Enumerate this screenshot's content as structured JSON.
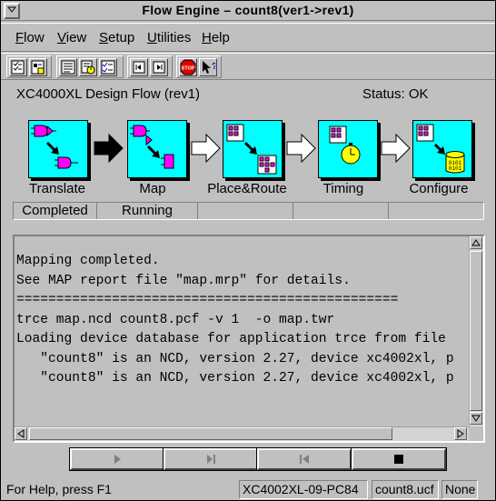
{
  "window": {
    "title": "Flow Engine – count8(ver1->rev1)"
  },
  "menubar": [
    {
      "label": "Flow",
      "key": "F",
      "rest": "low"
    },
    {
      "label": "View",
      "key": "V",
      "rest": "iew"
    },
    {
      "label": "Setup",
      "key": "S",
      "rest": "etup"
    },
    {
      "label": "Utilities",
      "key": "U",
      "rest": "tilities"
    },
    {
      "label": "Help",
      "key": "H",
      "rest": "elp"
    }
  ],
  "toolbar": {
    "icons": [
      "flow-options-icon",
      "implementation-options-icon",
      "report-browser-icon",
      "timing-report-icon",
      "check-list-icon",
      "step-back-icon",
      "step-forward-icon",
      "stop-icon",
      "context-help-icon"
    ],
    "stop_label": "STOP"
  },
  "design": {
    "title": "XC4000XL Design Flow (rev1)",
    "status": "Status: OK"
  },
  "flow": {
    "stages": [
      {
        "name": "Translate",
        "status": "Completed"
      },
      {
        "name": "Map",
        "status": "Running"
      },
      {
        "name": "Place&Route",
        "status": ""
      },
      {
        "name": "Timing",
        "status": ""
      },
      {
        "name": "Configure",
        "status": ""
      }
    ]
  },
  "log": {
    "lines": [
      "Mapping completed.",
      "See MAP report file \"map.mrp\" for details.",
      "",
      "================================================",
      "",
      "trce map.ncd count8.pcf -v 1  -o map.twr",
      "",
      "Loading device database for application trce from file",
      "   \"count8\" is an NCD, version 2.27, device xc4002xl, p",
      "",
      "   \"count8\" is an NCD, version 2.27, device xc4002xl, p"
    ]
  },
  "controls": {
    "icons": [
      "play-icon",
      "step-icon",
      "rewind-icon",
      "stop-square-icon"
    ]
  },
  "statusbar": {
    "help": "For Help, press F1",
    "device": "XC4002XL-09-PC84",
    "ucf": "count8.ucf",
    "mode": "None"
  },
  "colors": {
    "stage_fill": "#00ffff",
    "port_magenta": "#ff00ff",
    "timer_yellow": "#ffff00",
    "background": "#c0c0c0"
  }
}
